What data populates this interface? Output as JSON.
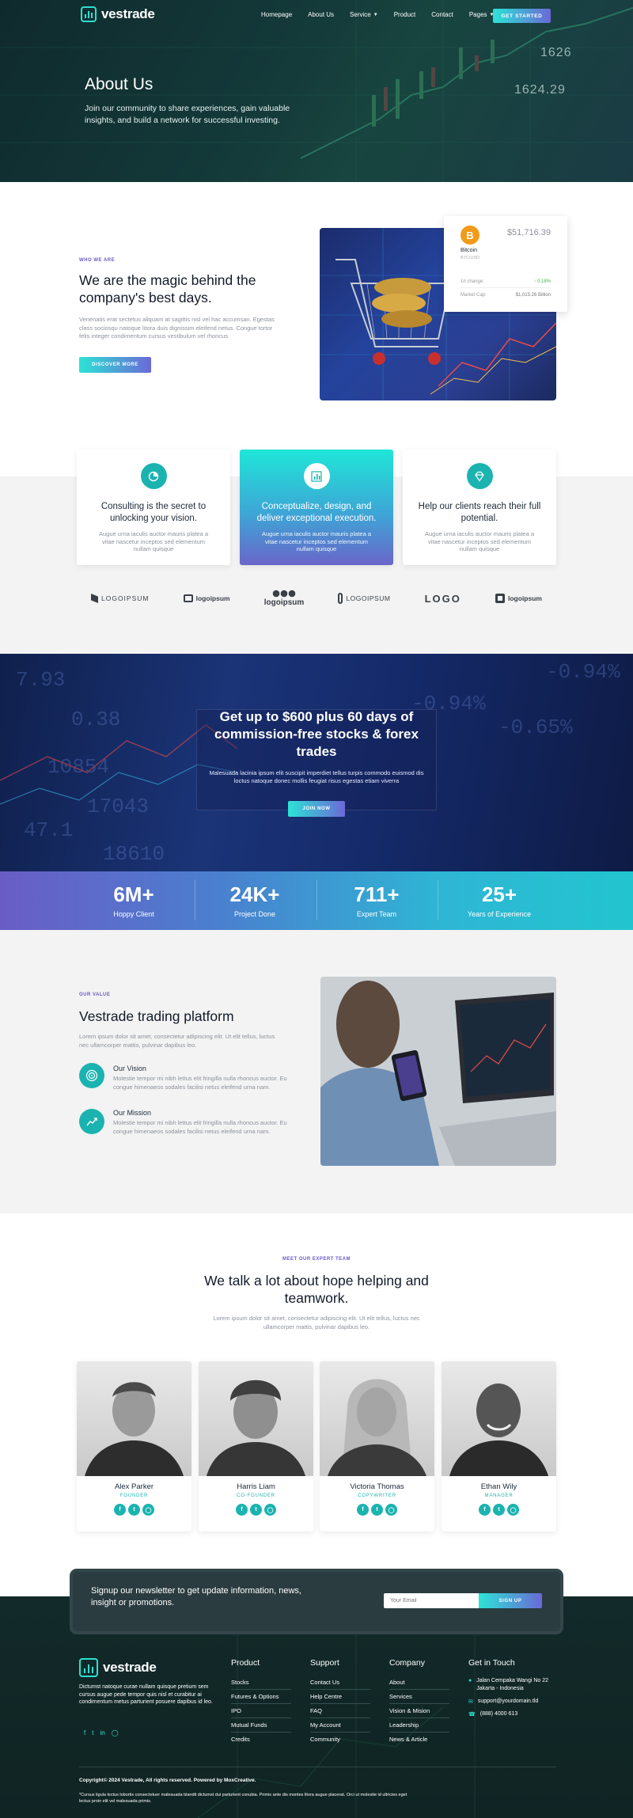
{
  "nav": {
    "brand": "vestrade",
    "items": [
      "Homepage",
      "About Us",
      "Service",
      "Product",
      "Contact",
      "Pages"
    ],
    "cta": "GET STARTED"
  },
  "hero": {
    "title": "About Us",
    "subtitle": "Join our community to share experiences, gain valuable insights, and build a network for successful investing.",
    "chart_labels": [
      "1626",
      "1624.29"
    ]
  },
  "who": {
    "tag": "WHO WE ARE",
    "title": "We are the magic behind the company's best days.",
    "body": "Venenatis erat sectetus aliquam at sagittis nisl vel hac accumsan. Egestas class sociosqu natoque litora duis dignissim eleifend netus. Congue tortor felis integer condimentum cursus vestibulum vel rhoncus.",
    "button": "DISCOVER MORE",
    "coin": {
      "price": "$51,716.39",
      "name": "Bitcoin",
      "pair": "BTC/USD",
      "change_label": "1h change:",
      "change_value": "0.18%",
      "cap_label": "Market Cap:",
      "cap_value": "$1,015.26 Billion"
    }
  },
  "services": [
    {
      "title": "Consulting is the secret to unlocking your vision.",
      "desc": "Augue urna iaculis auctor mauris platea a vitae nascetur inceptos sed elementum nullam quisque",
      "icon": "pie-chart-icon"
    },
    {
      "title": "Conceptualize, design, and deliver exceptional execution.",
      "desc": "Augue urna iaculis auctor mauris platea a vitae nascetur inceptos sed elementum nullam quisque",
      "icon": "bar-chart-icon"
    },
    {
      "title": "Help our clients reach their full potential.",
      "desc": "Augue urna iaculis auctor mauris platea a vitae nascetur inceptos sed elementum nullam quisque",
      "icon": "diamond-icon"
    }
  ],
  "brands": [
    "LOGOIPSUM",
    "logoipsum",
    "logoipsum",
    "LOGOIPSUM",
    "LOGO",
    "logoipsum"
  ],
  "promo": {
    "title": "Get up to $600 plus 60 days of commission-free stocks & forex trades",
    "body": "Malesuada lacinia ipsum elit suscipit imperdiet tellus turpis commodo euismod dis loctus natoque donec mollis feugiat risus egestas etiam viverra",
    "button": "JOIN NOW"
  },
  "stats": [
    {
      "value": "6M+",
      "label": "Hoppy Client"
    },
    {
      "value": "24K+",
      "label": "Project Done"
    },
    {
      "value": "711+",
      "label": "Expert Team"
    },
    {
      "value": "25+",
      "label": "Years of Experience"
    }
  ],
  "value": {
    "tag": "OUR VALUE",
    "title": "Vestrade trading platform",
    "body": "Lorem ipsum dolor sit amet, consectetur adipiscing elit. Ut elit tellus, luctus nec ullamcorper mattis, pulvinar dapibus leo.",
    "items": [
      {
        "title": "Our Vision",
        "text": "Molestie tempor mi nibh lettus elit fringilla nulla rhoncus auctor. Eu congue himenaeos sodales facilisi netus eleifend urna nam.",
        "icon": "target-icon"
      },
      {
        "title": "Our Mission",
        "text": "Molestie tempor mi nibh lettus elit fringilla nulla rhoncus auctor. Eu congue himenaeos sodales facilisi netus eleifend urna nam.",
        "icon": "growth-chart-icon"
      }
    ]
  },
  "team": {
    "tag": "MEET OUR EXPERT TEAM",
    "title": "We talk a lot about hope helping and teamwork.",
    "body": "Lorem ipsum dolor sit amet, consectetur adipiscing elit. Ut elit tellus, luctus nec ullamcorper mattis, pulvinar dapibus leo.",
    "members": [
      {
        "name": "Alex Parker",
        "role": "FOUNDER"
      },
      {
        "name": "Harris Liam",
        "role": "CO-FOUNDER"
      },
      {
        "name": "Victoria Thomas",
        "role": "COPYWRITER"
      },
      {
        "name": "Ethan Wily",
        "role": "MANAGER"
      }
    ]
  },
  "newsletter": {
    "text": "Signup our newsletter to get update information, news, insight or promotions.",
    "placeholder": "Your Email",
    "button": "SIGN UP"
  },
  "footer": {
    "brand": "vestrade",
    "about": "Dictumst natoque curae nullam quisque pretium sem cursus augue pede tempor quis nisl et curabitur ai condimentum metus parturient posuere dapibus id leo.",
    "columns": [
      {
        "title": "Product",
        "links": [
          "Stocks",
          "Futures & Options",
          "IPO",
          "Mutual Funds",
          "Credits"
        ]
      },
      {
        "title": "Support",
        "links": [
          "Contact Us",
          "Help Centre",
          "FAQ",
          "My Account",
          "Community"
        ]
      },
      {
        "title": "Company",
        "links": [
          "About",
          "Services",
          "Vision & Mision",
          "Leadership",
          "News & Article"
        ]
      }
    ],
    "contact": {
      "title": "Get in Touch",
      "address": "Jalan Cempaka Wangi No 22 Jakarta - Indonesia",
      "email": "support@yourdomain.tld",
      "phone": "(888) 4000 613"
    },
    "copyright": "Copyright© 2024 Vestrade, All rights reserved. Powered by MoxCreative.",
    "disclaimer": "*Cursus ligula lectus lobortis consectetuer malesuada blandit dictumst dui parturient conubia. Primis ante dis montes litora augue placerat. Orci ut molestie id ultricies eget lectus proin elit vel malesuada primis."
  },
  "colors": {
    "accent": "#1bb3b0",
    "gradient_start": "#2ce3d6",
    "gradient_end": "#6b69d6",
    "dark": "#0f2423"
  }
}
